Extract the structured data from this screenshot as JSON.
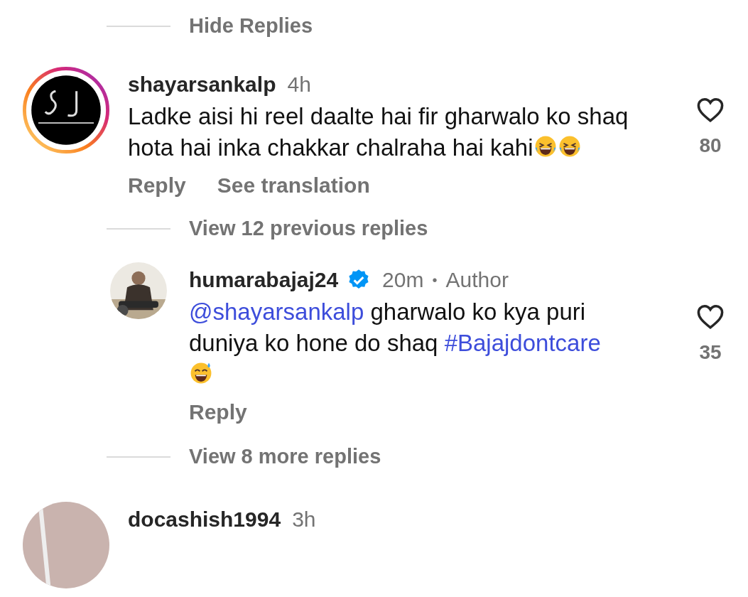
{
  "items": [
    {
      "kind": "toggle",
      "label": "Hide Replies"
    },
    {
      "kind": "comment",
      "username": "shayarsankalp",
      "story_ring": true,
      "time": "4h",
      "segments": [
        {
          "kind": "text",
          "text": "Ladke aisi hi reel daalte hai fir gharwalo ko shaq hota hai inka chakkar chalraha hai kahi"
        },
        {
          "kind": "laugh-emoji"
        },
        {
          "kind": "laugh-emoji"
        }
      ],
      "liked": false,
      "likes": "80",
      "actions": [
        "Reply",
        "See translation"
      ]
    },
    {
      "kind": "toggle",
      "label": "View 12 previous replies"
    },
    {
      "kind": "reply",
      "username": "humarabajaj24",
      "verified": true,
      "time": "20m",
      "dot": "•",
      "badge": "Author",
      "segments": [
        {
          "kind": "mention",
          "text": "@shayarsankalp"
        },
        {
          "kind": "text",
          "text": " gharwalo ko kya puri duniya ko hone do shaq "
        },
        {
          "kind": "hashtag",
          "text": "#Bajajdontcare"
        },
        {
          "kind": "sweat-emoji"
        }
      ],
      "liked": false,
      "likes": "35",
      "actions": [
        "Reply"
      ]
    },
    {
      "kind": "toggle",
      "label": "View 8 more replies"
    },
    {
      "kind": "comment",
      "username": "docashish1994",
      "time": "3h"
    }
  ]
}
